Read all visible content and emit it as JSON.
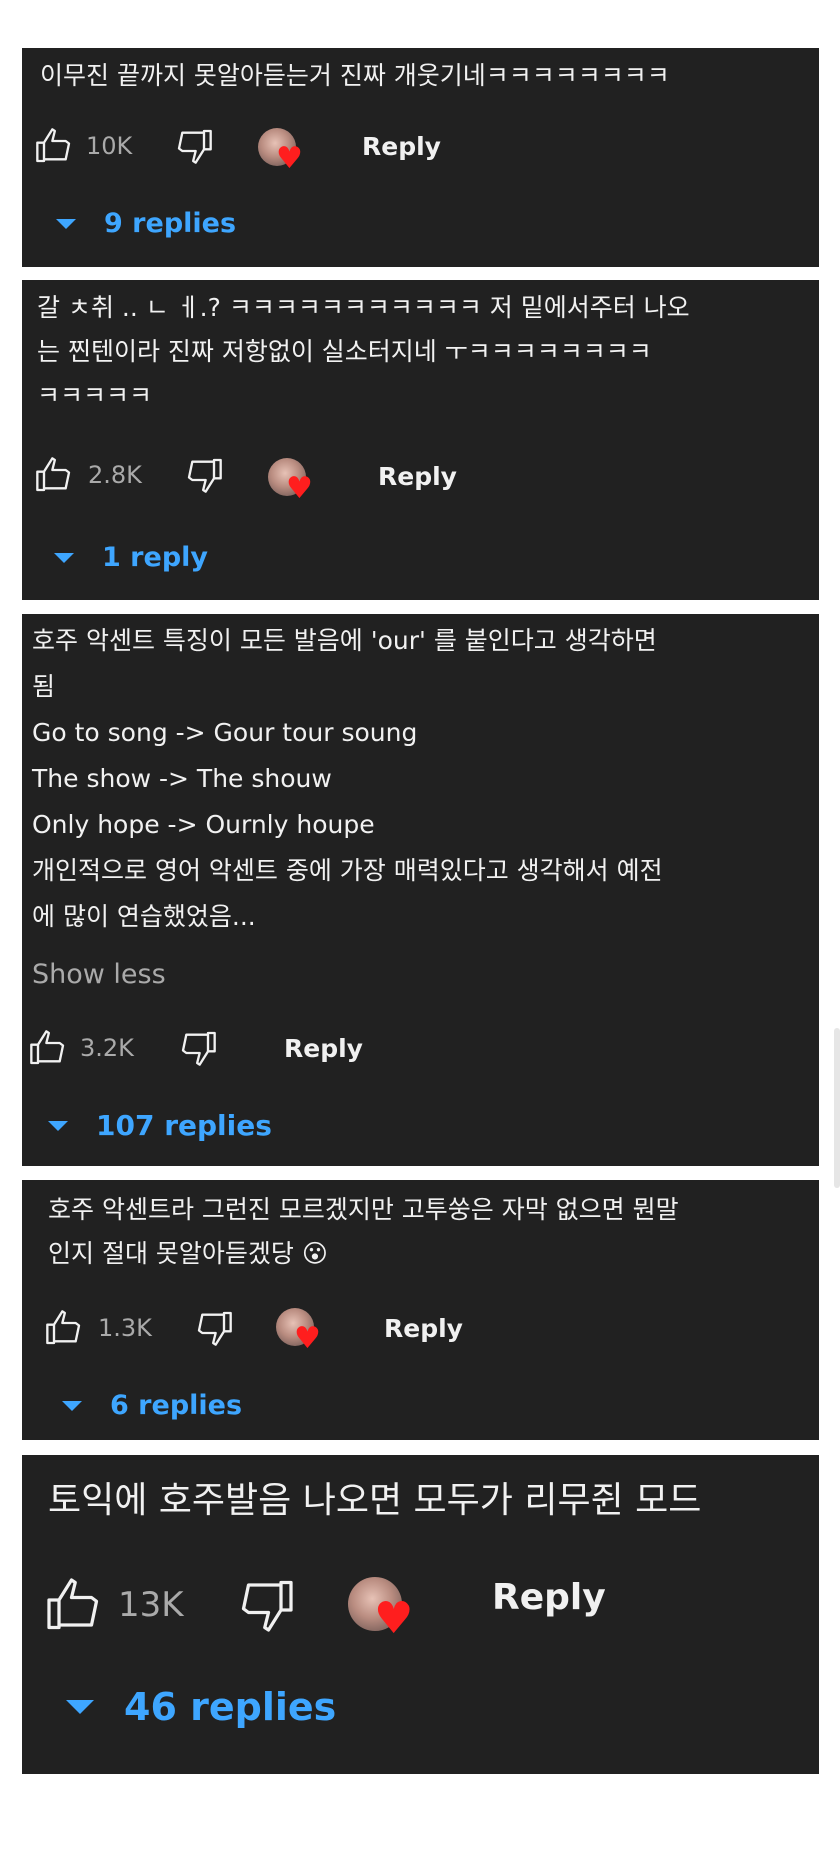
{
  "comments": [
    {
      "text": "이무진 끝까지 못알아듣는거 진짜 개웃기네ㅋㅋㅋㅋㅋㅋㅋㅋ",
      "likes": "10K",
      "reply_label": "Reply",
      "replies_label": "9 replies",
      "has_creator_heart": true
    },
    {
      "text": "갈 ㅊ취 .. ㄴ ㅔ.? ㅋㅋㅋㅋㅋㅋㅋㅋㅋㅋㅋ 저 밑에서주터 나오\n는 찐텐이라 진짜 저항없이 실소터지네 ㅜㅋㅋㅋㅋㅋㅋㅋㅋ\nㅋㅋㅋㅋㅋ",
      "likes": "2.8K",
      "reply_label": "Reply",
      "replies_label": "1 reply",
      "has_creator_heart": true
    },
    {
      "text": "호주 악센트 특징이 모든 발음에 'our' 를 붙인다고 생각하면\n됨\nGo to song -> Gour tour soung\nThe show -> The shouw\nOnly hope -> Ournly houpe\n개인적으로 영어 악센트 중에 가장 매력있다고 생각해서 예전\n에 많이 연습했었음...",
      "show_less_label": "Show less",
      "likes": "3.2K",
      "reply_label": "Reply",
      "replies_label": "107 replies",
      "has_creator_heart": false
    },
    {
      "text": "호주 악센트라 그런진 모르겠지만 고투쑹은 자막 없으면 뭔말\n인지 절대 못알아듣겠당 😮",
      "likes": "1.3K",
      "reply_label": "Reply",
      "replies_label": "6 replies",
      "has_creator_heart": true
    },
    {
      "text": "토익에 호주발음 나오면 모두가 리무쥔 모드",
      "likes": "13K",
      "reply_label": "Reply",
      "replies_label": "46 replies",
      "has_creator_heart": true
    }
  ],
  "icons": {
    "like": "thumbs-up-icon",
    "dislike": "thumbs-down-icon",
    "expand": "caret-down-icon",
    "creator_heart": "heart-icon"
  },
  "colors": {
    "card_background": "#212121",
    "text": "#f1f1f1",
    "secondary_text": "#aaaaaa",
    "link_blue": "#3ea6ff",
    "heart_red": "#ff1e1e"
  }
}
